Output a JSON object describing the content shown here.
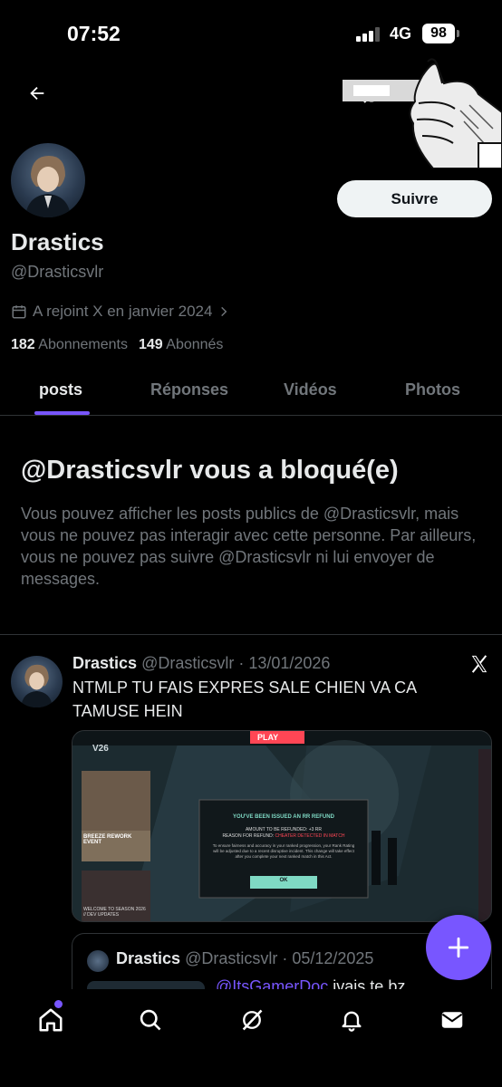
{
  "status_bar": {
    "time": "07:52",
    "network": "4G",
    "battery": "98"
  },
  "nav": {
    "back_icon": "arrow-left-icon",
    "grok_icon": "grok-icon",
    "search_icon": "search-icon",
    "more_icon": "more-horizontal-icon"
  },
  "profile": {
    "display_name": "Drastics",
    "handle": "@Drasticsvlr",
    "joined": "A rejoint X en janvier 2024",
    "following_count": "182",
    "following_label": "Abonnements",
    "followers_count": "149",
    "followers_label": "Abonnés",
    "follow_button": "Suivre"
  },
  "tabs": [
    {
      "label": "posts",
      "active": true
    },
    {
      "label": "Réponses",
      "active": false
    },
    {
      "label": "Vidéos",
      "active": false
    },
    {
      "label": "Photos",
      "active": false
    }
  ],
  "blocked": {
    "title": "@Drasticsvlr vous a bloqué(e)",
    "text": "Vous pouvez afficher les posts publics de @Drasticsvlr, mais vous ne pouvez pas interagir avec cette personne. Par ailleurs, vous ne pouvez pas suivre @Drasticsvlr ni lui envoyer de messages."
  },
  "post": {
    "name": "Drastics",
    "meta": "@Drasticsvlr · 13/01/2026",
    "text": "NTMLP TU FAIS EXPRES SALE CHIEN VA CA TAMUSE HEIN",
    "media": {
      "logo": "V26",
      "play": "PLAY",
      "dialog_title": "YOU'VE BEEN ISSUED AN RR REFUND",
      "amount_line": "AMOUNT TO BE REFUNDED: +3 RR",
      "reason_prefix": "REASON FOR REFUND: ",
      "reason_value": "CHEATER DETECTED IN MATCH",
      "body": "To ensure fairness and accuracy in your ranked progression, your Rank Rating will be adjusted due to a recent disruptive incident. This change will take effect after you complete your next ranked match in this Act.",
      "ok": "OK",
      "left_card_title": "BREEZE REWORK EVENT",
      "left_card_bottom": "WELCOME TO SEASON 2026 // DEV UPDATES"
    },
    "quote": {
      "name": "Drastics",
      "meta": "@Drasticsvlr · 05/12/2025",
      "mention": "@ItsGamerDoc",
      "text_rest": " jvais te bz"
    }
  },
  "fab": {
    "icon": "plus-icon"
  },
  "bottom_nav": [
    "home-icon",
    "search-icon",
    "grok-icon",
    "notifications-icon",
    "messages-icon"
  ],
  "colors": {
    "accent": "#7856ff",
    "muted": "#71767b",
    "text": "#e7e9ea",
    "background": "#000000",
    "refund_red": "#ff4655"
  }
}
